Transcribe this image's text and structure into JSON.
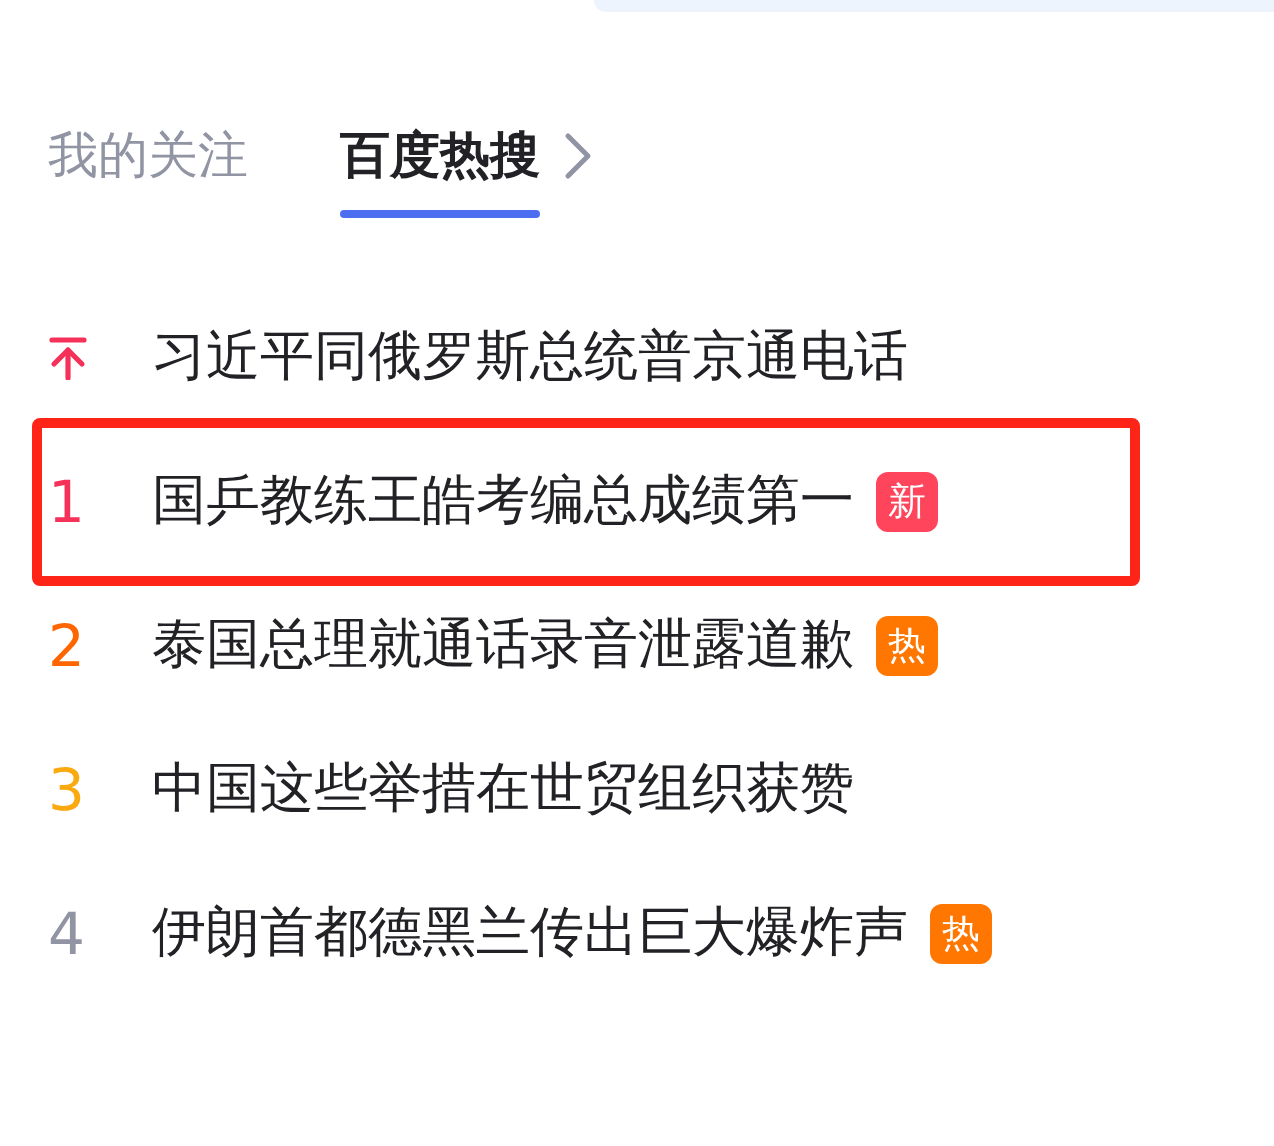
{
  "tabs": [
    {
      "label": "我的关注",
      "selected": false
    },
    {
      "label": "百度热搜",
      "selected": true
    }
  ],
  "hot_list": [
    {
      "kind": "pinned",
      "title": "习近平同俄罗斯总统普京通电话",
      "color": "#f5315a",
      "highlighted": false
    },
    {
      "kind": "ranked",
      "rank": "1",
      "title": "国乒教练王皓考编总成绩第一",
      "color": "#f5315a",
      "badge": {
        "text": "新",
        "color": "#ff455b"
      },
      "highlighted": true
    },
    {
      "kind": "ranked",
      "rank": "2",
      "title": "泰国总理就通话录音泄露道歉",
      "color": "#ff6600",
      "badge": {
        "text": "热",
        "color": "#ff7700"
      },
      "highlighted": false
    },
    {
      "kind": "ranked",
      "rank": "3",
      "title": "中国这些举措在世贸组织获赞",
      "color": "#faa90e",
      "highlighted": false
    },
    {
      "kind": "ranked",
      "rank": "4",
      "title": "伊朗首都德黑兰传出巨大爆炸声",
      "color": "#9195a3",
      "badge": {
        "text": "热",
        "color": "#ff7700"
      },
      "highlighted": false
    }
  ]
}
